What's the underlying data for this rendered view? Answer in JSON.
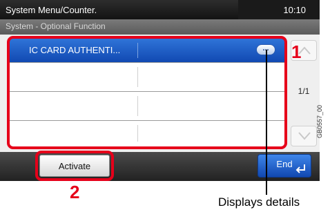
{
  "header": {
    "title": "System Menu/Counter.",
    "time": "10:10",
    "breadcrumb": "System - Optional Function"
  },
  "list": {
    "rows": [
      {
        "label": "IC CARD AUTHENTI...",
        "selected": true,
        "detail_label": "..."
      },
      {
        "label": "",
        "selected": false
      },
      {
        "label": "",
        "selected": false
      },
      {
        "label": "",
        "selected": false
      }
    ],
    "page_indicator": "1/1"
  },
  "footer": {
    "activate_label": "Activate",
    "end_label": "End"
  },
  "annotations": {
    "marker_1": "1",
    "marker_2": "2",
    "details_caption": "Displays details",
    "figure_code": "GB0557_00"
  },
  "colors": {
    "selected_row": "#1a56c4",
    "callout": "#e6001a"
  }
}
